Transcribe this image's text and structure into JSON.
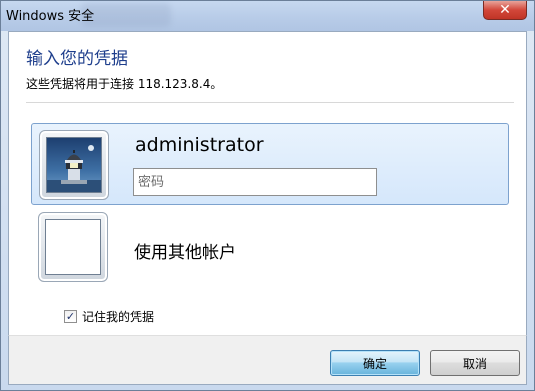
{
  "window": {
    "title": "Windows 安全",
    "close_label": "✕"
  },
  "content": {
    "heading": "输入您的凭据",
    "subtext": "这些凭据将用于连接 118.123.8.4。"
  },
  "account": {
    "username": "administrator",
    "password_placeholder": "密码",
    "password_value": ""
  },
  "other_account": {
    "label": "使用其他帐户"
  },
  "remember": {
    "label": "记住我的凭据",
    "checked": true,
    "check_glyph": "✓"
  },
  "buttons": {
    "ok_label": "确定",
    "cancel_label": "取消"
  },
  "icons": {
    "user_avatar": "lighthouse-avatar-icon",
    "blank_avatar": "blank-avatar-icon",
    "close": "close-icon"
  }
}
